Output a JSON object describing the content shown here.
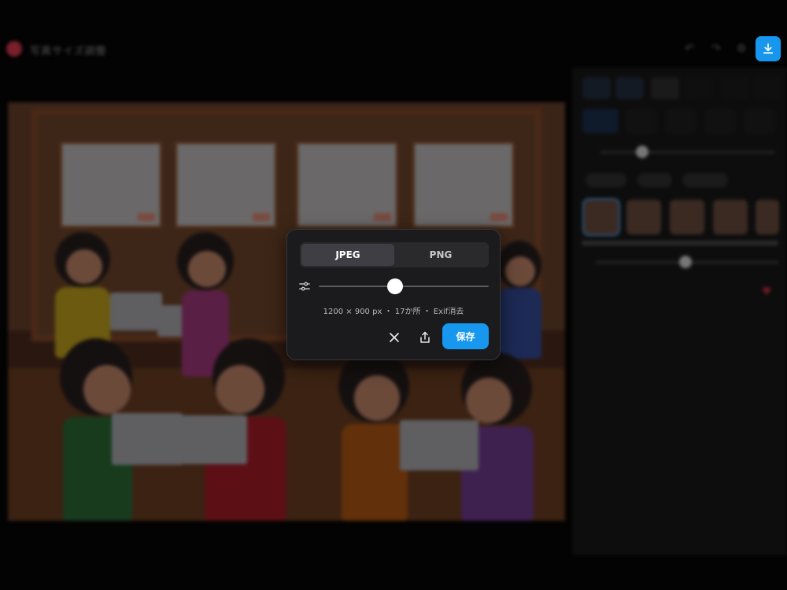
{
  "app": {
    "title": "写真サイズ調整"
  },
  "colors": {
    "accent": "#1797ee",
    "background": "#030303",
    "modal_bg": "#1b1b1e"
  },
  "export_dialog": {
    "formats": [
      {
        "label": "JPEG",
        "selected": true
      },
      {
        "label": "PNG",
        "selected": false
      }
    ],
    "quality_level": 0.45,
    "info": "1200 × 900 px ・ 17か所 ・ Exif消去",
    "save_label": "保存",
    "icons": {
      "settings": "sliders-icon",
      "close": "close-icon",
      "share": "share-icon",
      "download": "download-icon"
    }
  }
}
